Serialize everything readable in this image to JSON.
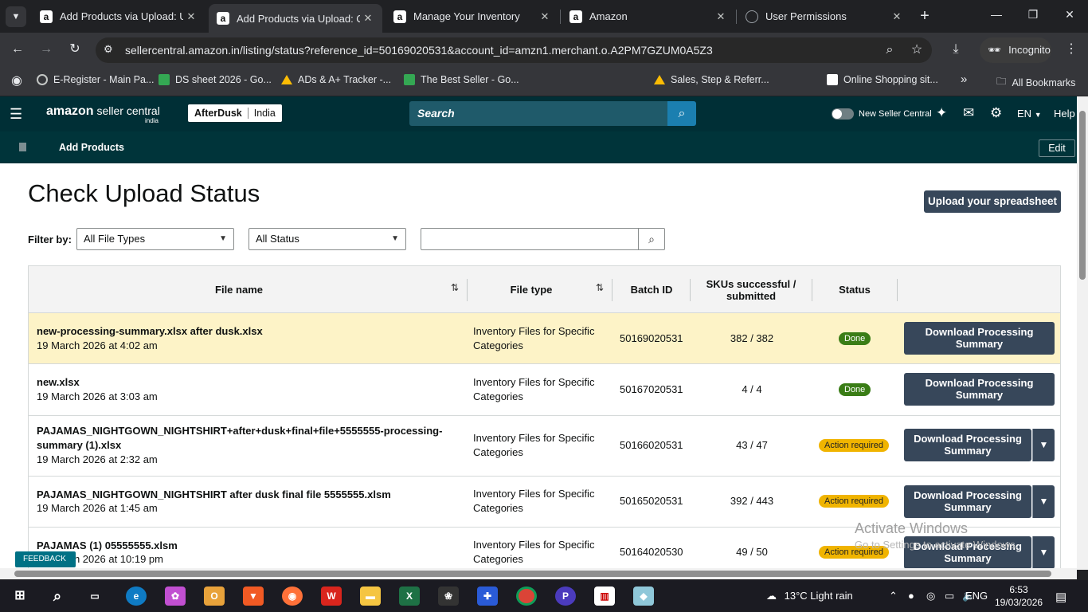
{
  "browser": {
    "tabs": [
      {
        "title": "Add Products via Upload: Up",
        "active": false
      },
      {
        "title": "Add Products via Upload: Ch",
        "active": true
      },
      {
        "title": "Manage Your Inventory",
        "active": false
      },
      {
        "title": "Amazon",
        "active": false
      },
      {
        "title": "User Permissions",
        "active": false
      }
    ],
    "url": "sellercentral.amazon.in/listing/status?reference_id=50169020531&account_id=amzn1.merchant.o.A2PM7GZUM0A5Z3",
    "incognito_label": "Incognito",
    "bookmarks": [
      "E-Register - Main Pa...",
      "DS sheet 2026 - Go...",
      "ADs & A+ Tracker -...",
      "The Best Seller - Go...",
      "Sales, Step & Referr...",
      "Online Shopping sit..."
    ],
    "all_bookmarks": "All Bookmarks",
    "overflow": "»"
  },
  "header": {
    "logo_main": "amazon",
    "logo_sub": " seller central",
    "logo_country": "india",
    "store_name": "AfterDusk",
    "store_region": "India",
    "search_placeholder": "Search",
    "new_seller_central": "New Seller Central",
    "language": "EN",
    "help": "Help",
    "sub_title": "Add Products",
    "edit": "Edit"
  },
  "page": {
    "title": "Check Upload Status",
    "upload_button": "Upload your spreadsheet",
    "filter_label": "Filter by:",
    "file_type_filter": "All File Types",
    "status_filter": "All Status"
  },
  "table": {
    "headers": {
      "file_name": "File name",
      "file_type": "File type",
      "batch_id": "Batch ID",
      "skus": "SKUs successful / submitted",
      "status": "Status"
    },
    "rows": [
      {
        "file": "new-processing-summary.xlsx after dusk.xlsx",
        "date": "19 March 2026 at 4:02 am",
        "type": "Inventory Files for Specific Categories",
        "batch": "50169020531",
        "skus": "382 / 382",
        "status": "Done",
        "action": "Download Processing Summary"
      },
      {
        "file": "new.xlsx",
        "date": "19 March 2026 at 3:03 am",
        "type": "Inventory Files for Specific Categories",
        "batch": "50167020531",
        "skus": "4 / 4",
        "status": "Done",
        "action": "Download Processing Summary"
      },
      {
        "file": "PAJAMAS_NIGHTGOWN_NIGHTSHIRT+after+dusk+final+file+5555555-processing-summary (1).xlsx",
        "date": "19 March 2026 at 2:32 am",
        "type": "Inventory Files for Specific Categories",
        "batch": "50166020531",
        "skus": "43 / 47",
        "status": "Action required",
        "action": "Download Processing Summary"
      },
      {
        "file": "PAJAMAS_NIGHTGOWN_NIGHTSHIRT after dusk final file 5555555.xlsm",
        "date": "19 March 2026 at 1:45 am",
        "type": "Inventory Files for Specific Categories",
        "batch": "50165020531",
        "skus": "392 / 443",
        "status": "Action required",
        "action": "Download Processing Summary"
      },
      {
        "file": "PAJAMAS (1) 05555555.xlsm",
        "date": "18 March 2026 at 10:19 pm",
        "type": "Inventory Files for Specific Categories",
        "batch": "50164020530",
        "skus": "49 / 50",
        "status": "Action required",
        "action": "Download Processing Summary"
      }
    ]
  },
  "overlay": {
    "feedback": "FEEDBACK",
    "watermark_title": "Activate Windows",
    "watermark_sub": "Go to Settings to activate Windows."
  },
  "taskbar": {
    "weather": "13°C  Light rain",
    "lang": "ENG",
    "time": "6:53",
    "date": "19/03/2026"
  }
}
